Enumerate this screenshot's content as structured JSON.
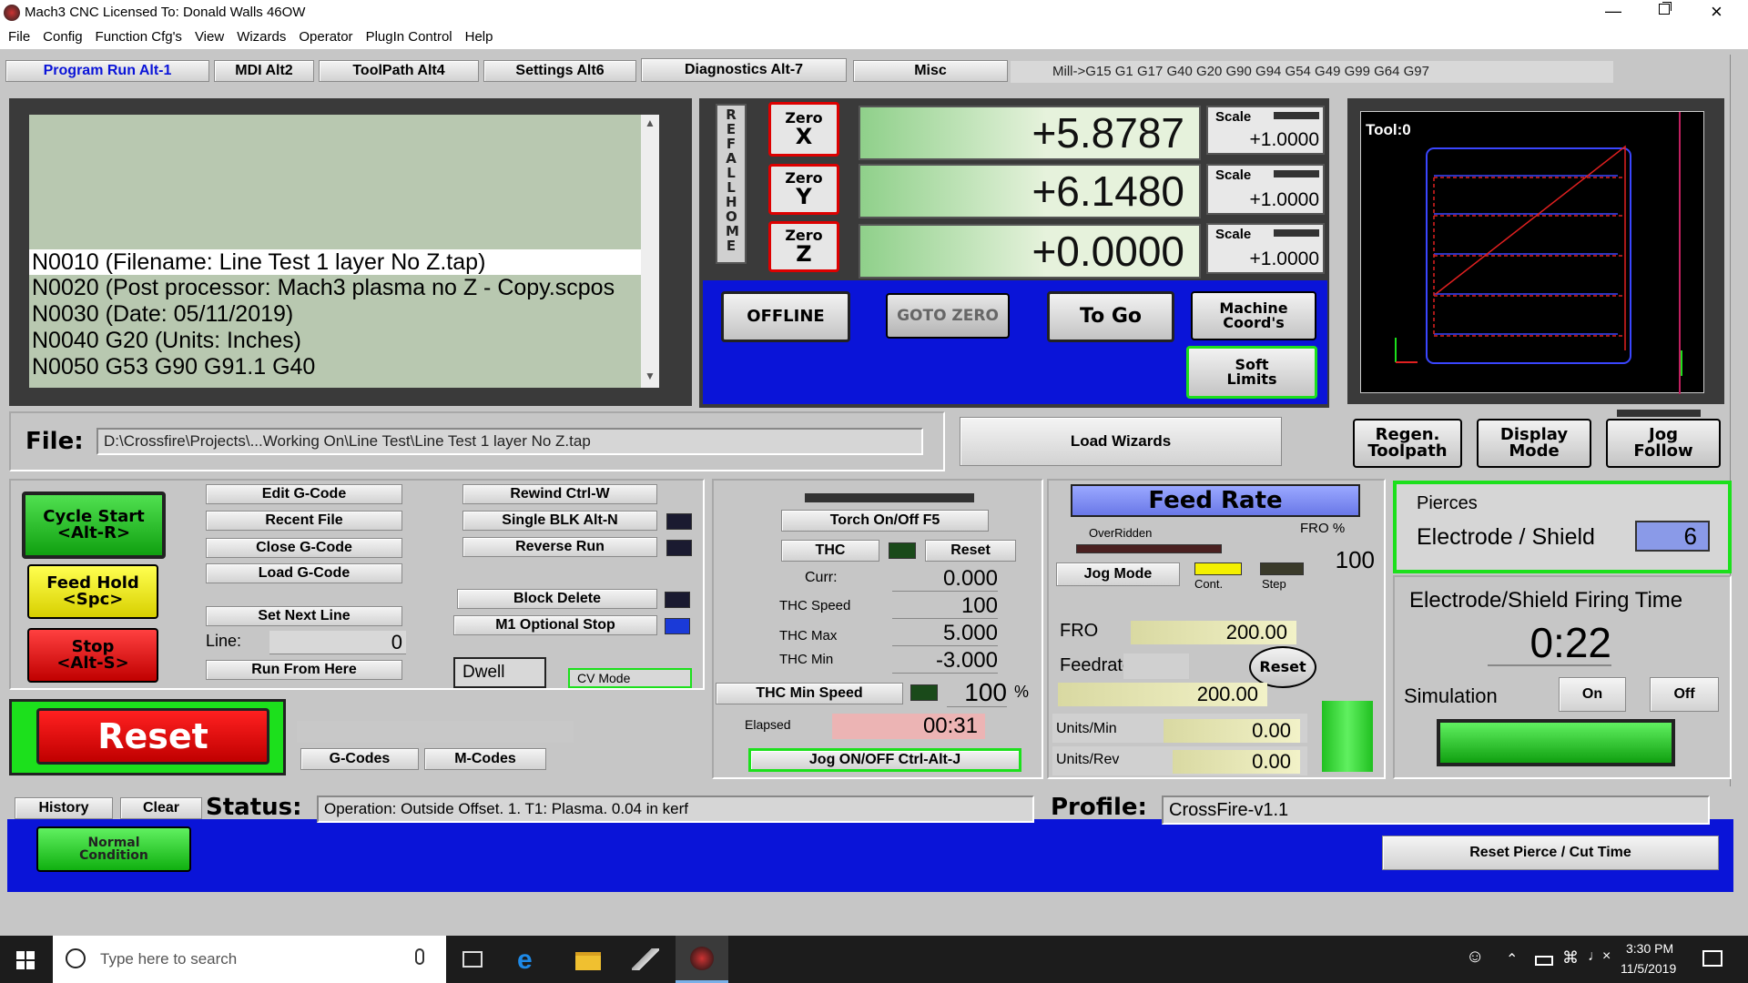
{
  "window": {
    "title": "Mach3 CNC  Licensed To: Donald Walls 46OW"
  },
  "menu": [
    "File",
    "Config",
    "Function Cfg's",
    "View",
    "Wizards",
    "Operator",
    "PlugIn Control",
    "Help"
  ],
  "tabs": [
    "Program Run Alt-1",
    "MDI Alt2",
    "ToolPath Alt4",
    "Settings Alt6",
    "Diagnostics Alt-7",
    "Misc"
  ],
  "modal": "Mill->G15  G1 G17 G40 G20 G90 G94 G54 G49 G99 G64 G97",
  "gcode": {
    "lines": [
      "N0010 (Filename: Line Test 1 layer No Z.tap)",
      "N0020 (Post processor: Mach3 plasma no Z - Copy.scpos",
      "N0030 (Date: 05/11/2019)",
      "N0040 G20 (Units: Inches)",
      "N0050 G53 G90 G91.1 G40"
    ]
  },
  "axes": {
    "ref_all_home": "REF ALL HOME",
    "zero_label": "Zero",
    "items": [
      {
        "axis": "X",
        "value": "+5.8787",
        "scale_label": "Scale",
        "scale": "+1.0000"
      },
      {
        "axis": "Y",
        "value": "+6.1480",
        "scale_label": "Scale",
        "scale": "+1.0000"
      },
      {
        "axis": "Z",
        "value": "+0.0000",
        "scale_label": "Scale",
        "scale": "+1.0000"
      }
    ]
  },
  "dro_buttons": {
    "offline": "OFFLINE",
    "goto_zero": "GOTO ZERO",
    "to_go": "To Go",
    "machine_coords": "Machine Coord's",
    "soft_limits": "Soft Limits"
  },
  "tool": {
    "label": "Tool:0"
  },
  "file": {
    "label": "File:",
    "path": "D:\\Crossfire\\Projects\\...Working On\\Line Test\\Line Test 1 layer No Z.tap",
    "load_wizards": "Load Wizards"
  },
  "view_buttons": {
    "regen": "Regen. Toolpath",
    "display": "Display Mode",
    "jog_follow": "Jog Follow"
  },
  "cycle": {
    "start": "Cycle Start <Alt-R>",
    "hold": "Feed Hold <Spc>",
    "stop": "Stop <Alt-S>"
  },
  "file_buttons": {
    "edit": "Edit G-Code",
    "recent": "Recent File",
    "close": "Close G-Code",
    "load": "Load G-Code",
    "set_next": "Set Next Line",
    "line_label": "Line:",
    "line_value": "0",
    "run_from": "Run From Here"
  },
  "run_buttons": {
    "rewind": "Rewind Ctrl-W",
    "single": "Single BLK Alt-N",
    "reverse": "Reverse Run",
    "block_delete": "Block Delete",
    "m1": "M1 Optional Stop",
    "dwell": "Dwell",
    "cv": "CV Mode"
  },
  "reset": {
    "label": "Reset",
    "gcodes": "G-Codes",
    "mcodes": "M-Codes"
  },
  "thc": {
    "torch": "Torch On/Off F5",
    "thc": "THC",
    "reset": "Reset",
    "curr_label": "Curr:",
    "curr": "0.000",
    "speed_label": "THC Speed",
    "speed": "100",
    "max_label": "THC Max",
    "max": "5.000",
    "min_label": "THC Min",
    "min": "-3.000",
    "min_speed": "THC Min Speed",
    "min_speed_val": "100",
    "pct": "%",
    "elapsed_label": "Elapsed",
    "elapsed": "00:31",
    "jog": "Jog ON/OFF Ctrl-Alt-J"
  },
  "feed": {
    "title": "Feed Rate",
    "overridden": "OverRidden",
    "fro_pct_label": "FRO %",
    "fro_pct": "100",
    "jog_mode": "Jog Mode",
    "cont": "Cont.",
    "step": "Step",
    "fro_label": "FRO",
    "fro": "200.00",
    "feedrate_label": "Feedrate",
    "feedrate": "200.00",
    "reset": "Reset",
    "units_min_label": "Units/Min",
    "units_min": "0.00",
    "units_rev_label": "Units/Rev",
    "units_rev": "0.00"
  },
  "pierce": {
    "pierces": "Pierces",
    "electrode": "Electrode / Shield",
    "count": "6",
    "firing_label": "Electrode/Shield Firing Time",
    "firing_time": "0:22",
    "simulation": "Simulation",
    "on": "On",
    "off": "Off"
  },
  "status": {
    "history": "History",
    "clear": "Clear",
    "label": "Status:",
    "text": "Operation: Outside Offset. 1. T1: Plasma. 0.04 in kerf",
    "profile_label": "Profile:",
    "profile": "CrossFire-v1.1",
    "normal": "Normal Condition",
    "reset_pierce": "Reset Pierce / Cut Time"
  },
  "taskbar": {
    "search": "Type here to search",
    "time": "3:30 PM",
    "date": "11/5/2019"
  },
  "colors": {
    "accent_blue": "#0a14d8",
    "led_green": "#1ce01c",
    "reset_red": "#d40000",
    "hold_yellow": "#f4f000"
  }
}
